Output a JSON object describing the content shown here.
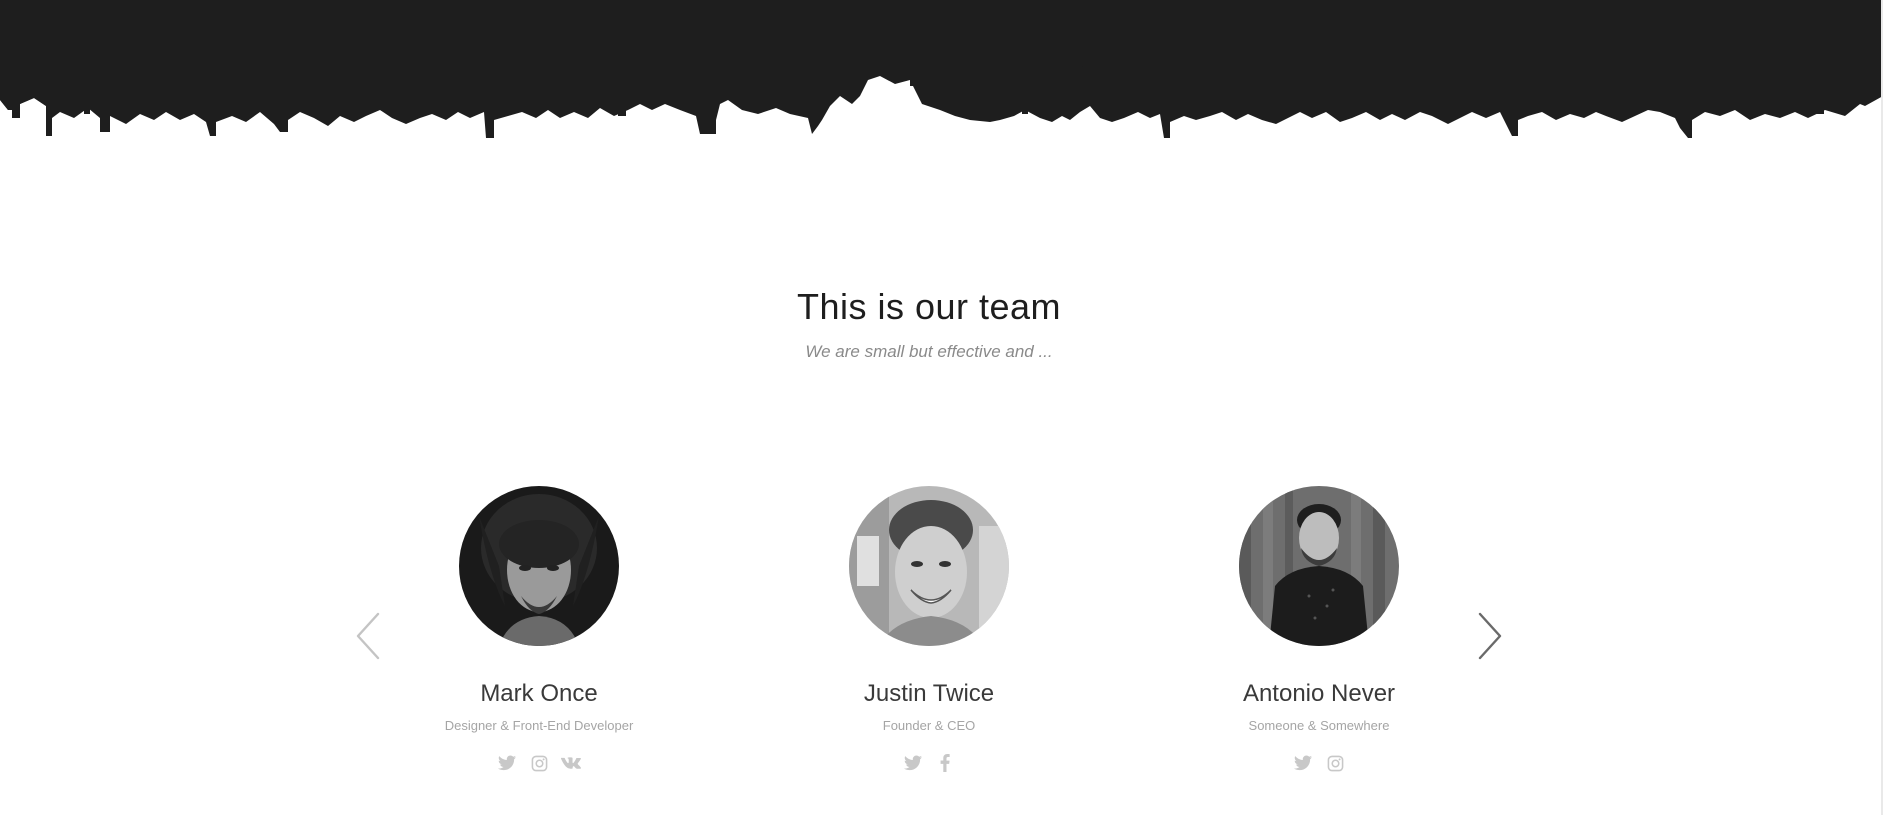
{
  "header": {
    "title": "This is our team",
    "subtitle": "We are small but effective and ..."
  },
  "carousel": {
    "prev_icon": "chevron-left-icon",
    "next_icon": "chevron-right-icon",
    "members": [
      {
        "name": "Mark Once",
        "role": "Designer & Front-End Developer",
        "photo": "grayscale portrait with dark background, long wavy hair and beard",
        "socials": [
          "twitter-icon",
          "instagram-icon",
          "vk-icon"
        ]
      },
      {
        "name": "Justin Twice",
        "role": "Founder & CEO",
        "photo": "grayscale portrait smiling, short hair, city background",
        "socials": [
          "twitter-icon",
          "facebook-icon"
        ]
      },
      {
        "name": "Antonio Never",
        "role": "Someone & Somewhere",
        "photo": "grayscale portrait with wooden background, dark shirt",
        "socials": [
          "twitter-icon",
          "instagram-icon"
        ]
      }
    ]
  },
  "colors": {
    "skyline": "#1e1e1e",
    "title": "#1e1e1e",
    "subtitle": "#8a8a8a",
    "name": "#3a3a3a",
    "role": "#a5a5a5",
    "social": "#c8c8c8",
    "arrow_prev": "#c4c4c4",
    "arrow_next": "#6a6a6a"
  }
}
